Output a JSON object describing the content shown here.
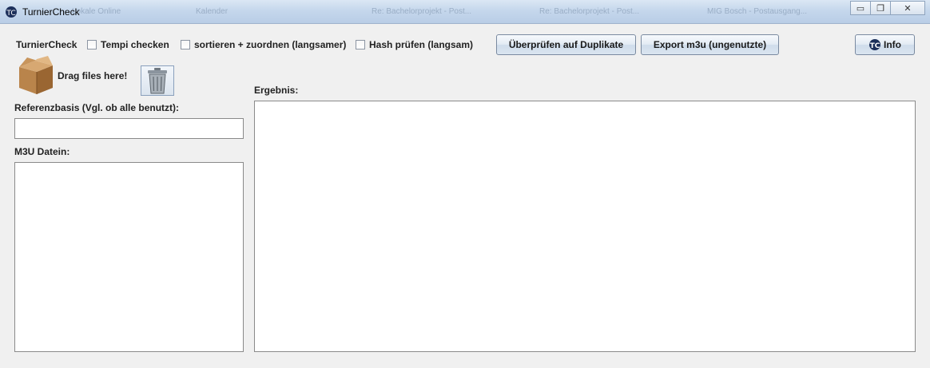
{
  "window": {
    "title": "TurnierCheck",
    "background_tabs": [
      "Lokale Online",
      "Kalender",
      "Re: Bachelorprojekt - Post...",
      "Re: Bachelorprojekt - Post...",
      "MIG Bosch - Postausgang..."
    ]
  },
  "toolbar": {
    "app_label": "TurnierCheck",
    "checkboxes": [
      {
        "label": "Tempi checken",
        "checked": false
      },
      {
        "label": "sortieren + zuordnen (langsamer)",
        "checked": false
      },
      {
        "label": "Hash prüfen (langsam)",
        "checked": false
      }
    ],
    "check_duplicates_label": "Überprüfen auf Duplikate",
    "export_label": "Export m3u (ungenutzte)",
    "info_label": "Info"
  },
  "drop_zone": {
    "label": "Drag files here!",
    "icon": "cardboard-box-icon",
    "trash_icon": "trash-can-icon"
  },
  "reference": {
    "label": "Referenzbasis (Vgl. ob alle benutzt):",
    "value": ""
  },
  "m3u": {
    "label": "M3U Datein:"
  },
  "result": {
    "label": "Ergebnis:"
  }
}
